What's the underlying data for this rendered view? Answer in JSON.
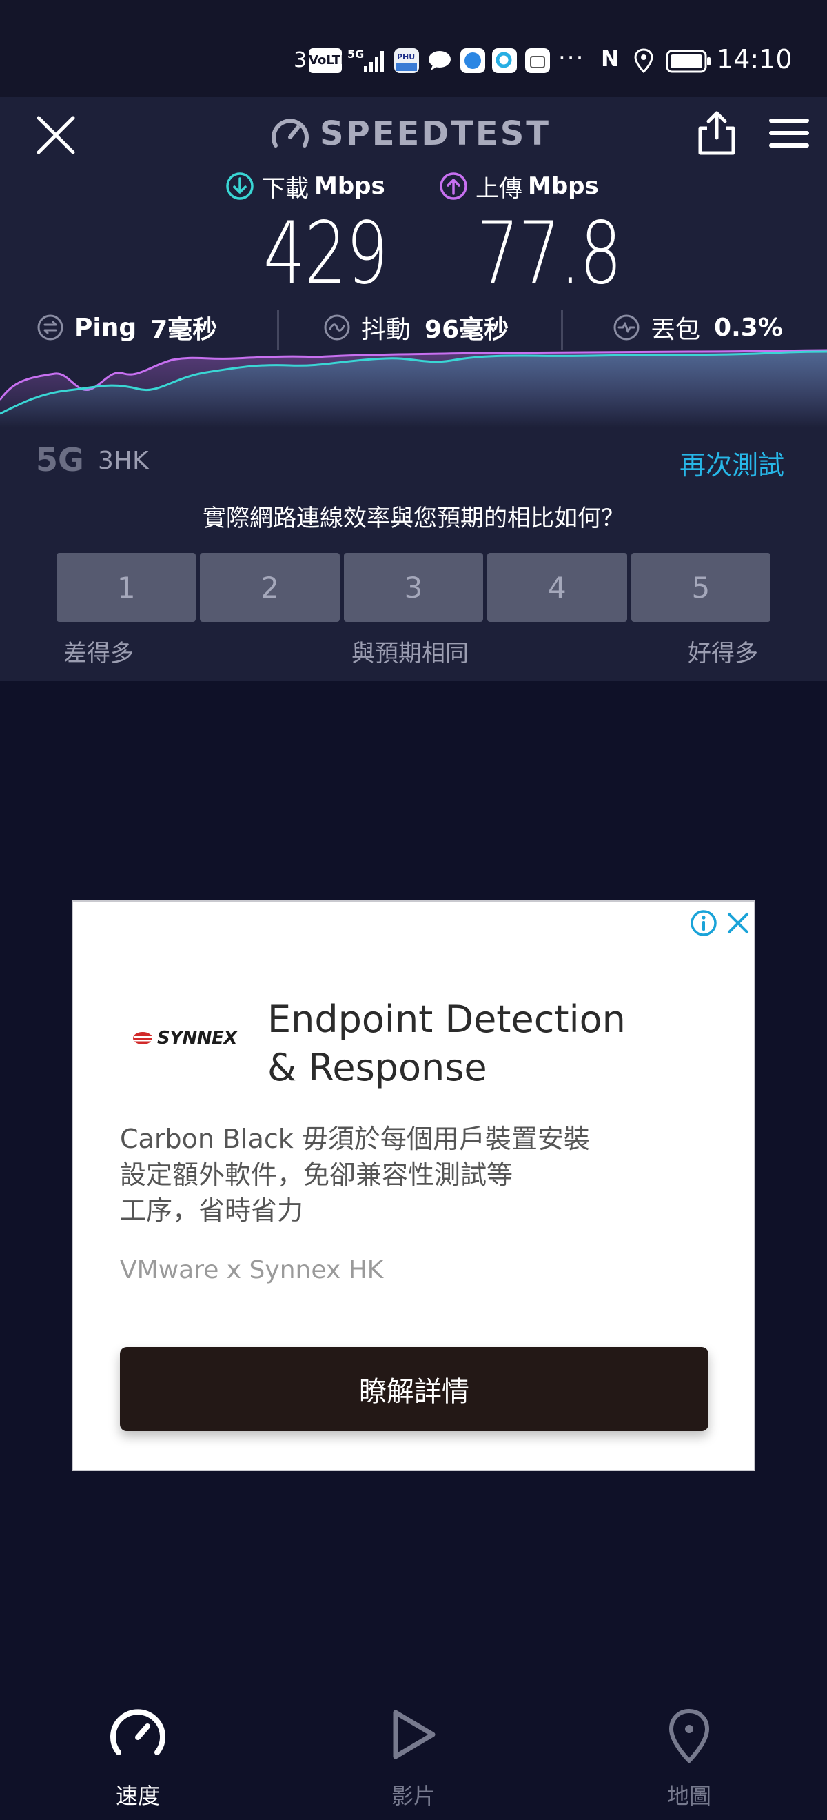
{
  "status_bar": {
    "carrier_index": "3",
    "volte_badge": "VoLTE",
    "network_badge": "5G",
    "more_indicator": "···",
    "nfc_label": "N",
    "time": "14:10"
  },
  "header": {
    "brand": "SPEEDTEST",
    "close_icon": "close-icon",
    "share_icon": "share-icon",
    "menu_icon": "menu-icon"
  },
  "results": {
    "download": {
      "label": "下載",
      "unit": "Mbps",
      "value": "429",
      "color": "#3ad6d4"
    },
    "upload": {
      "label": "上傳",
      "unit": "Mbps",
      "value": "77.8",
      "color": "#c770f0"
    },
    "ping": {
      "label": "Ping",
      "value": "7毫秒"
    },
    "jitter": {
      "label": "抖動",
      "value": "96毫秒"
    },
    "packet_loss": {
      "label": "丟包",
      "value": "0.3%"
    }
  },
  "connection": {
    "type": "5G",
    "carrier": "3HK",
    "retest_label": "再次測試"
  },
  "rating": {
    "question": "實際網路連線效率與您預期的相比如何？",
    "options": [
      "1",
      "2",
      "3",
      "4",
      "5"
    ],
    "caption_low": "差得多",
    "caption_mid": "與預期相同",
    "caption_high": "好得多"
  },
  "ad": {
    "logo_text": "SYNNEX",
    "title_line1": "Endpoint Detection",
    "title_line2": "& Response",
    "body_line1": "Carbon Black 毋須於每個用戶裝置安裝",
    "body_line2": "設定額外軟件，免卻兼容性測試等",
    "body_line3": "工序，省時省力",
    "sponsor": "VMware x Synnex HK",
    "cta": "瞭解詳情"
  },
  "bottom_nav": {
    "speed": "速度",
    "video": "影片",
    "map": "地圖"
  },
  "colors": {
    "background": "#0f1128",
    "panel": "#1d2039",
    "accent_blue": "#27b7e8",
    "download_line": "#3ad6d4",
    "upload_line": "#c770f0"
  }
}
